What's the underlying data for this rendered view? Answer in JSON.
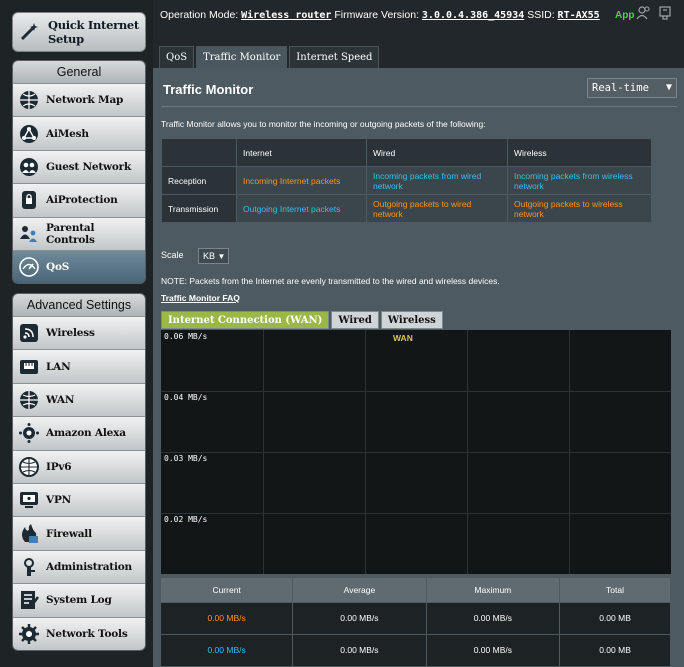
{
  "sidebar": {
    "quick_setup": "Quick Internet Setup",
    "general_header": "General",
    "general_items": [
      {
        "label": "Network Map",
        "icon": "globe-icon"
      },
      {
        "label": "AiMesh",
        "icon": "aimesh-icon"
      },
      {
        "label": "Guest Network",
        "icon": "guest-network-icon"
      },
      {
        "label": "AiProtection",
        "icon": "lock-icon"
      },
      {
        "label": "Parental Controls",
        "icon": "parental-controls-icon"
      },
      {
        "label": "QoS",
        "icon": "qos-icon"
      }
    ],
    "advanced_header": "Advanced Settings",
    "advanced_items": [
      {
        "label": "Wireless",
        "icon": "wireless-icon"
      },
      {
        "label": "LAN",
        "icon": "lan-icon"
      },
      {
        "label": "WAN",
        "icon": "wan-globe-icon"
      },
      {
        "label": "Amazon Alexa",
        "icon": "alexa-icon"
      },
      {
        "label": "IPv6",
        "icon": "ipv6-icon"
      },
      {
        "label": "VPN",
        "icon": "vpn-icon"
      },
      {
        "label": "Firewall",
        "icon": "firewall-icon"
      },
      {
        "label": "Administration",
        "icon": "administration-icon"
      },
      {
        "label": "System Log",
        "icon": "system-log-icon"
      },
      {
        "label": "Network Tools",
        "icon": "network-tools-icon"
      }
    ]
  },
  "topbar": {
    "op_mode_label": "Operation Mode:",
    "op_mode_value": "Wireless router",
    "firmware_label": "Firmware Version:",
    "firmware_value": "3.0.0.4.386_45934",
    "ssid_label": "SSID:",
    "ssid_value": "RT-AX55",
    "app_label": "App"
  },
  "tabs": [
    "QoS",
    "Traffic Monitor",
    "Internet Speed"
  ],
  "panel": {
    "title": "Traffic Monitor",
    "mode_select": "Real-time",
    "description": "Traffic Monitor allows you to monitor the incoming or outgoing packets of the following:",
    "legend": {
      "headers": [
        "",
        "Internet",
        "Wired",
        "Wireless"
      ],
      "reception": {
        "label": "Reception",
        "internet": "Incoming Internet packets",
        "wired": "Incoming packets from wired network",
        "wireless": "Incoming packets from wireless network"
      },
      "transmission": {
        "label": "Transmission",
        "internet": "Outgoing Internet packets",
        "wired": "Outgoing packets to wired network",
        "wireless": "Outgoing packets to wireless network"
      }
    },
    "scale_label": "Scale",
    "scale_value": "KB",
    "note": "NOTE: Packets from the Internet are evenly transmitted to the wired and wireless devices.",
    "faq_link": "Traffic Monitor FAQ",
    "graph_tabs": [
      "Internet Connection (WAN)",
      "Wired",
      "Wireless"
    ],
    "graph": {
      "series_label": "WAN",
      "y_labels": [
        "0.06 MB/s",
        "0.04 MB/s",
        "0.03 MB/s",
        "0.02 MB/s"
      ]
    },
    "stats": {
      "headers": [
        "Current",
        "Average",
        "Maximum",
        "Total"
      ],
      "rows": [
        {
          "current": "0.00 MB/s",
          "average": "0.00 MB/s",
          "maximum": "0.00 MB/s",
          "total": "0.00 MB",
          "color": "#f7941d"
        },
        {
          "current": "0.00 MB/s",
          "average": "0.00 MB/s",
          "maximum": "0.00 MB/s",
          "total": "0.00 MB",
          "color": "#3cbde9"
        }
      ]
    }
  },
  "colors": {
    "orange": "#f7941d",
    "cyan": "#3cbde9",
    "app_green": "#4cd24c",
    "wan_tab": "#9ab845"
  }
}
